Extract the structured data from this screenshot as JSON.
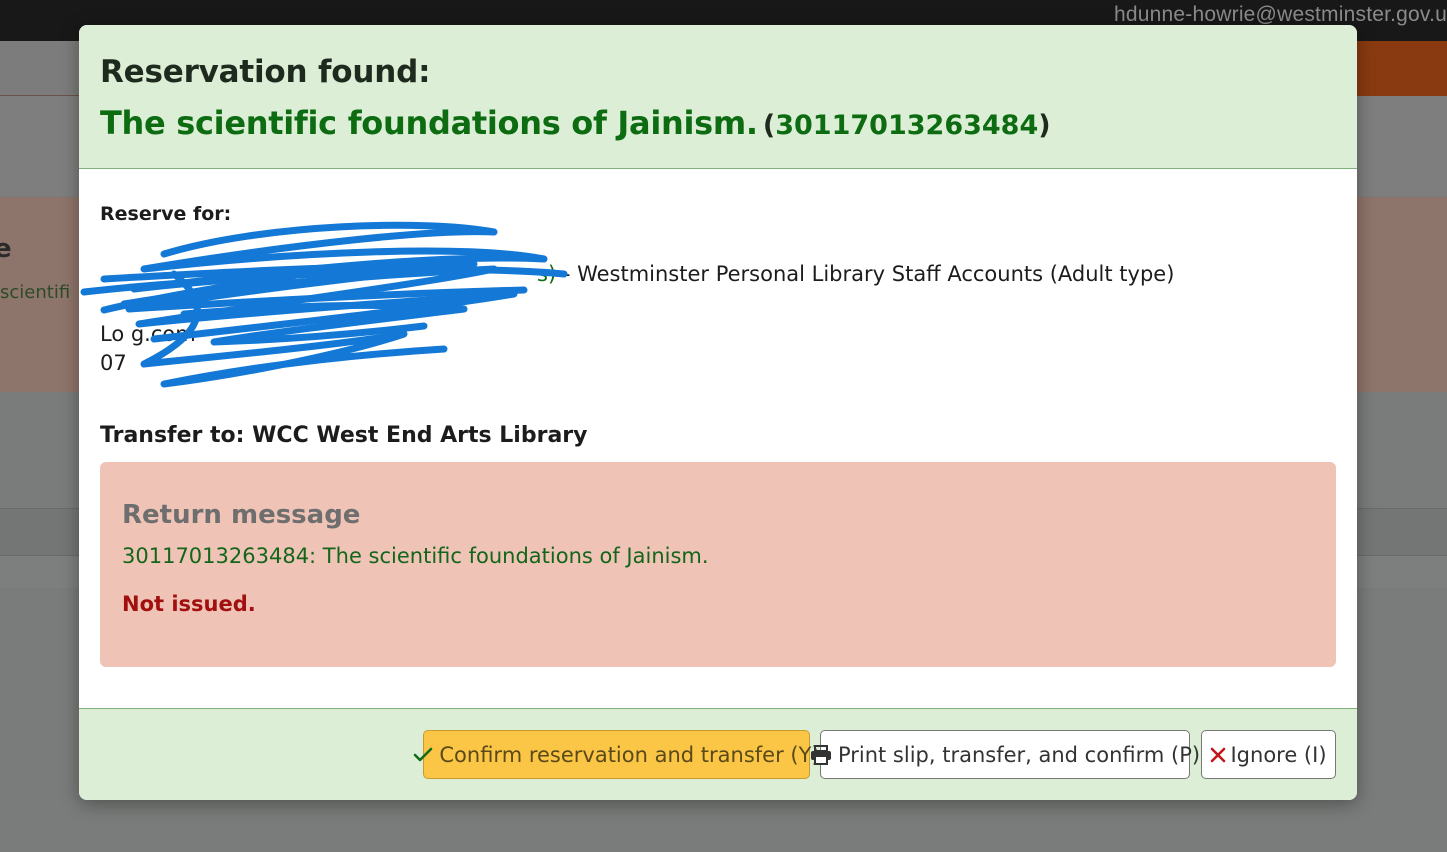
{
  "background": {
    "user_email": "hdunne-howrie@westminster.gov.u",
    "alert_title_fragment": "e",
    "alert_text_fragment": "scientifi"
  },
  "modal": {
    "title": "Reservation found:",
    "book_title": "The scientific foundations of Jainism.",
    "barcode_open": "(",
    "barcode": "30117013263484",
    "barcode_close": ")",
    "reserve_for_label": "Reserve for:",
    "patron_redacted_suffix": "s)",
    "patron_category": " - Westminster Personal Library Staff Accounts (Adult type)",
    "patron_line2_fragment": "Lo          g.com",
    "patron_line3_fragment": "07",
    "transfer_label": "Transfer to:",
    "transfer_library": "WCC West End Arts Library",
    "return_message": {
      "heading": "Return message",
      "item": "30117013263484: The scientific foundations of Jainism.",
      "status": "Not issued."
    },
    "buttons": {
      "confirm": "Confirm reservation and transfer (Y)",
      "print": "Print slip, transfer, and confirm (P)",
      "ignore": "Ignore (I)"
    }
  },
  "colors": {
    "header_bg": "#dcefd6",
    "title_green": "#0d6b12",
    "return_box_bg": "#efc4b6",
    "status_red": "#a10f0f",
    "confirm_button": "#fbc545",
    "redaction_blue": "#1479d6"
  },
  "icons": {
    "confirm": "check-icon",
    "print": "printer-icon",
    "ignore": "close-icon"
  }
}
